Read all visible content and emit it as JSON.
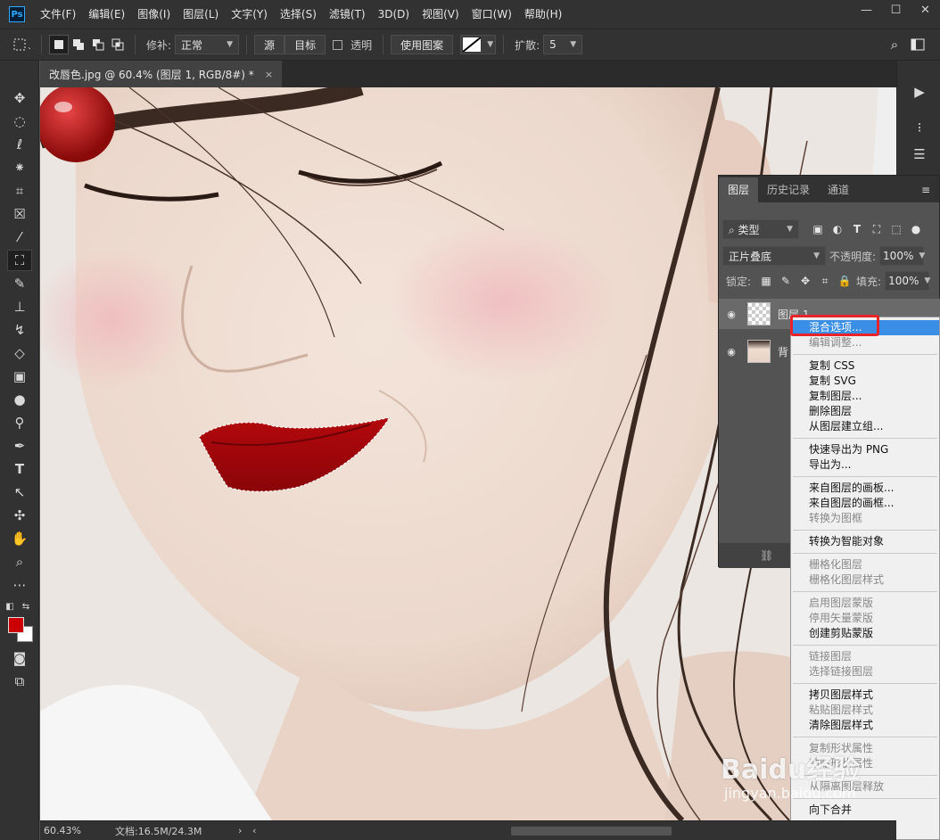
{
  "app": {
    "logo": "Ps",
    "menu": [
      "文件(F)",
      "编辑(E)",
      "图像(I)",
      "图层(L)",
      "文字(Y)",
      "选择(S)",
      "滤镜(T)",
      "3D(D)",
      "视图(V)",
      "窗口(W)",
      "帮助(H)"
    ],
    "window_controls": {
      "minimize": "—",
      "maximize": "☐",
      "close": "✕"
    }
  },
  "options": {
    "repair_label": "修补:",
    "repair_mode": "正常",
    "source_button": "源",
    "target_button": "目标",
    "transparent_label": "透明",
    "use_pattern_button": "使用图案",
    "diffusion_label": "扩散:",
    "diffusion_value": "5"
  },
  "document": {
    "tab_title": "改唇色.jpg @ 60.4% (图层 1, RGB/8#) *",
    "tab_close": "×"
  },
  "status": {
    "zoom": "60.43%",
    "doc_size": "文档:16.5M/24.3M",
    "arrow": "›",
    "nav_left": "‹"
  },
  "colors": {
    "foreground": "#cc0000",
    "background": "#ffffff",
    "highlight": "#3a8ee6",
    "annotation": "#e8232a"
  },
  "layers_panel": {
    "tabs": [
      "图层",
      "历史记录",
      "通道"
    ],
    "active_tab": "图层",
    "filter_kind": "类型",
    "blend_mode": "正片叠底",
    "opacity_label": "不透明度:",
    "opacity_value": "100%",
    "lock_label": "锁定:",
    "fill_label": "填充:",
    "fill_value": "100%",
    "layers": [
      {
        "name": "图层 1",
        "selected": true
      },
      {
        "name": "背",
        "selected": false
      }
    ]
  },
  "context_menu": {
    "groups": [
      [
        {
          "label": "混合选项...",
          "disabled": false,
          "highlighted": true
        },
        {
          "label": "编辑调整...",
          "disabled": true
        }
      ],
      [
        {
          "label": "复制 CSS",
          "disabled": false
        },
        {
          "label": "复制 SVG",
          "disabled": false
        },
        {
          "label": "复制图层...",
          "disabled": false
        },
        {
          "label": "删除图层",
          "disabled": false
        },
        {
          "label": "从图层建立组...",
          "disabled": false
        }
      ],
      [
        {
          "label": "快速导出为 PNG",
          "disabled": false
        },
        {
          "label": "导出为...",
          "disabled": false
        }
      ],
      [
        {
          "label": "来自图层的画板...",
          "disabled": false
        },
        {
          "label": "来自图层的画框...",
          "disabled": false
        },
        {
          "label": "转换为图框",
          "disabled": true
        }
      ],
      [
        {
          "label": "转换为智能对象",
          "disabled": false
        }
      ],
      [
        {
          "label": "栅格化图层",
          "disabled": true
        },
        {
          "label": "栅格化图层样式",
          "disabled": true
        }
      ],
      [
        {
          "label": "启用图层蒙版",
          "disabled": true
        },
        {
          "label": "停用矢量蒙版",
          "disabled": true
        },
        {
          "label": "创建剪贴蒙版",
          "disabled": false
        }
      ],
      [
        {
          "label": "链接图层",
          "disabled": true
        },
        {
          "label": "选择链接图层",
          "disabled": true
        }
      ],
      [
        {
          "label": "拷贝图层样式",
          "disabled": false
        },
        {
          "label": "粘贴图层样式",
          "disabled": true
        },
        {
          "label": "清除图层样式",
          "disabled": false
        }
      ],
      [
        {
          "label": "复制形状属性",
          "disabled": true
        },
        {
          "label": "粘贴形状属性",
          "disabled": true
        }
      ],
      [
        {
          "label": "从隔离图层释放",
          "disabled": true
        }
      ],
      [
        {
          "label": "向下合并",
          "disabled": false
        }
      ]
    ]
  },
  "watermark": {
    "brand": "Baidu经验",
    "url": "jingyan.baidu.com"
  }
}
